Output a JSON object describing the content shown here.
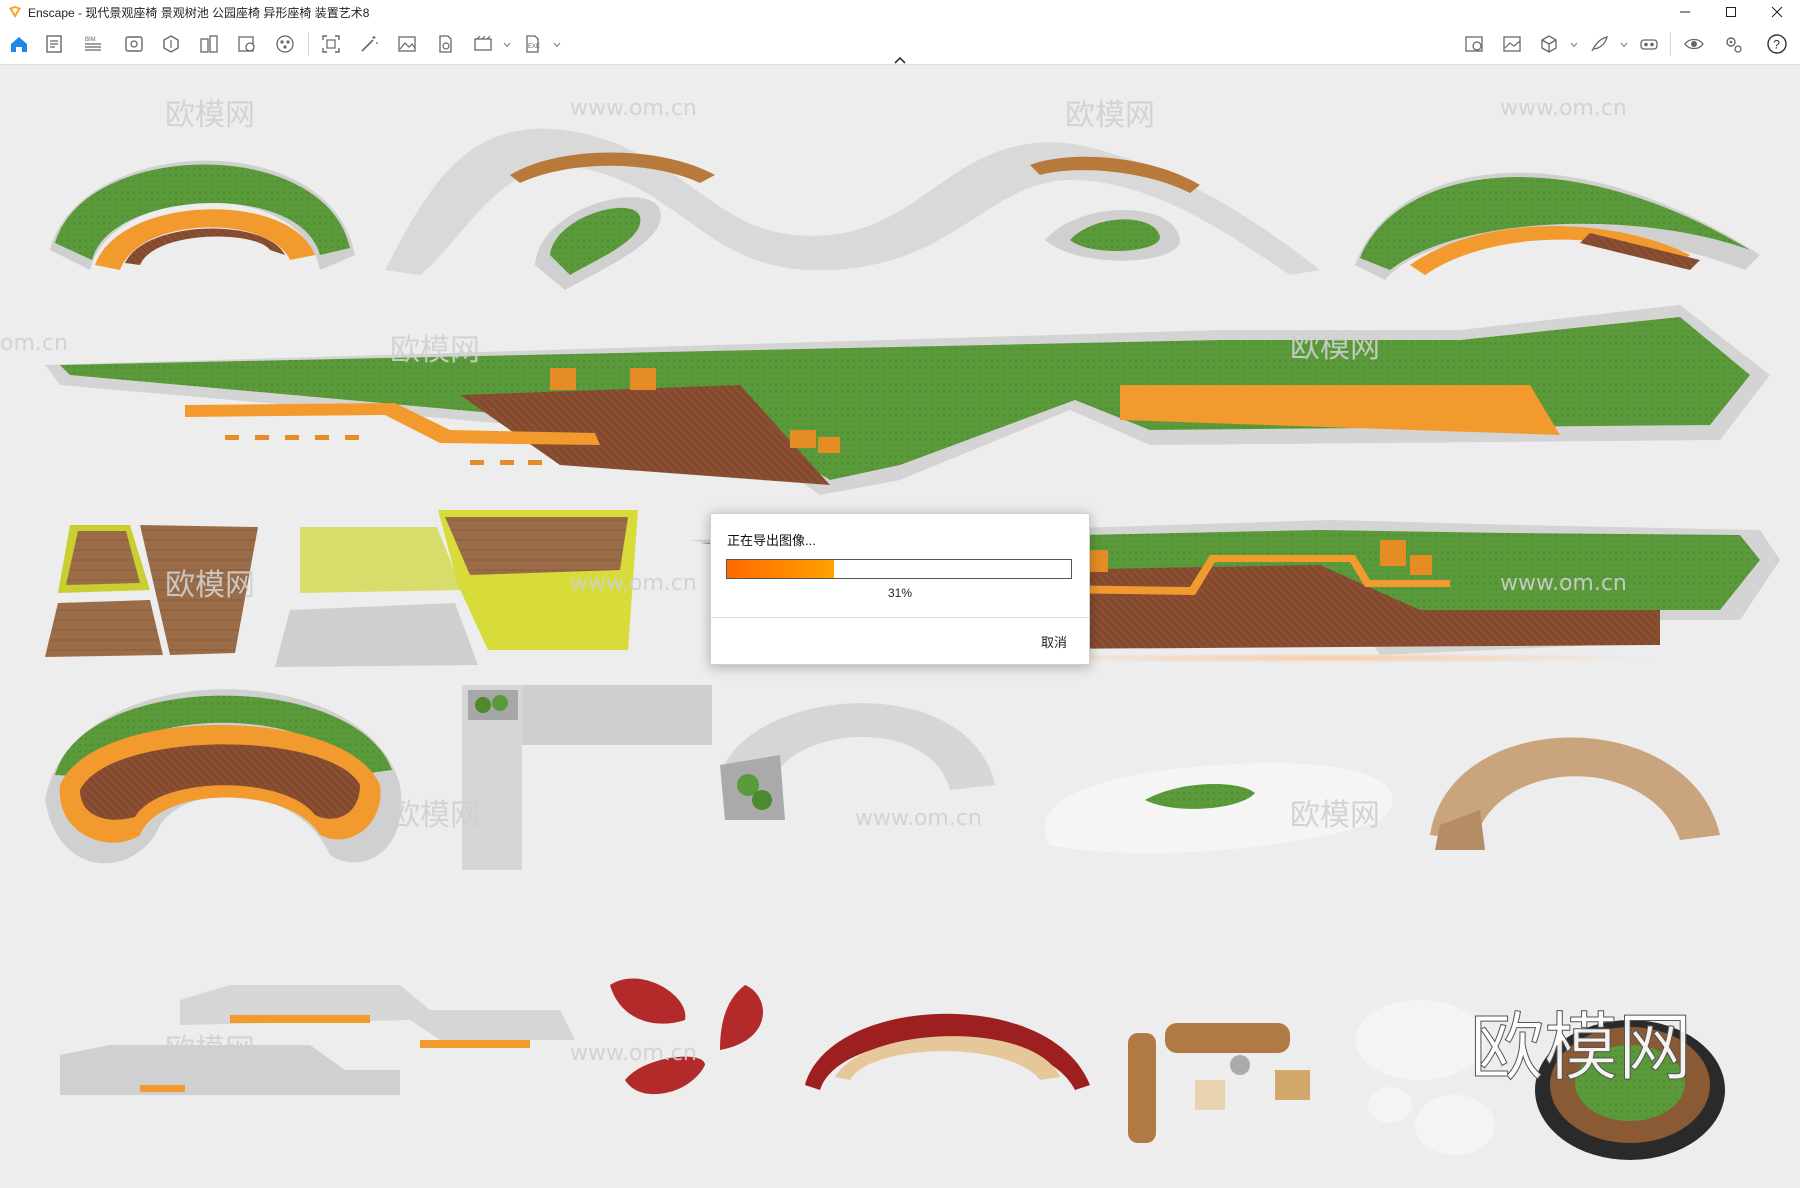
{
  "app": {
    "title": "Enscape - 现代景观座椅 景观树池 公园座椅 异形座椅 装置艺术8",
    "accent_color": "#1e88e5"
  },
  "window_controls": {
    "minimize": "—",
    "maximize": "☐",
    "close": "✕"
  },
  "toolbar": {
    "left_icons": [
      "home-icon",
      "project-info-icon",
      "bim-icon",
      "visual-settings-icon",
      "asset-library-icon",
      "material-editor-icon",
      "site-context-icon",
      "scene-icon",
      "view-management-icon",
      "magic-wand-icon",
      "screenshot-icon",
      "export-file-icon",
      "batch-render-icon",
      "exe-export-icon"
    ],
    "right_icons": [
      "image-compare-icon",
      "gallery-icon",
      "cube-view-icon",
      "feather-icon",
      "vr-headset-icon",
      "visibility-icon",
      "settings-icon",
      "help-icon"
    ],
    "bim_label": "BIM",
    "exe_label": "EXE"
  },
  "watermarks": {
    "site_text": "www.om.cn",
    "logo_small": "欧模网",
    "logo_big": "欧模网",
    "partial": "om.cn"
  },
  "dialog": {
    "title": "正在导出图像...",
    "progress_percent_value": 31,
    "percent_label": "31%",
    "cancel_label": "取消"
  },
  "colors": {
    "grass": "#5a9a3a",
    "concrete": "#d6d6d6",
    "wood": "#8a4f32",
    "orange": "#f39a2e",
    "yellow": "#d8dc3a",
    "red": "#b32a2a",
    "tan": "#c9a47d"
  }
}
